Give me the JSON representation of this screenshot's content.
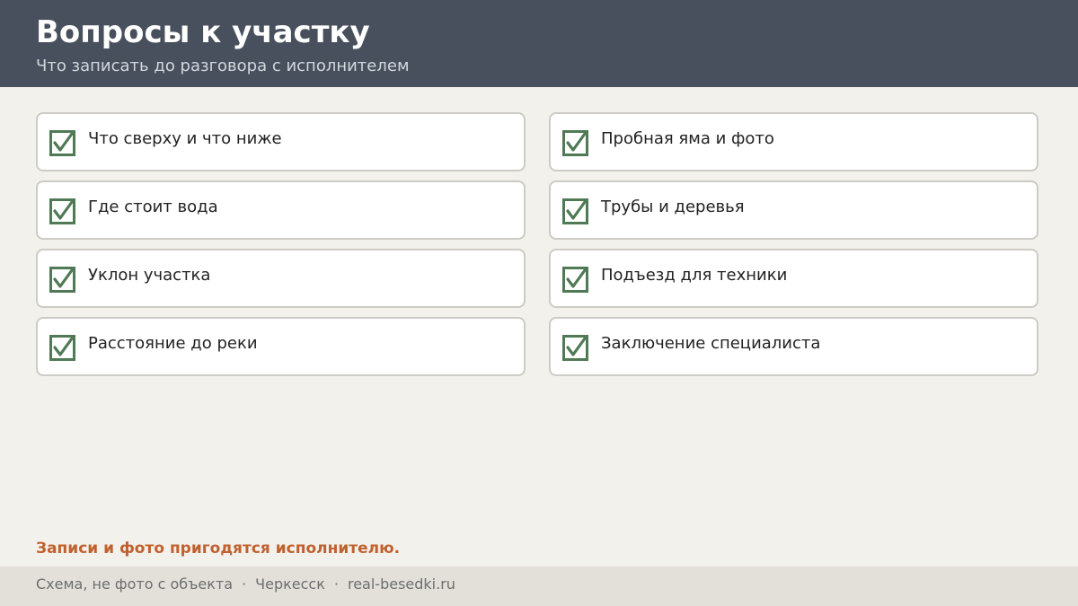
{
  "header": {
    "title": "Вопросы к участку",
    "subtitle": "Что записать до разговора с исполнителем"
  },
  "checklist": {
    "items": [
      {
        "label": "Что сверху и что ниже",
        "checked": true
      },
      {
        "label": "Пробная яма и фото",
        "checked": true
      },
      {
        "label": "Где стоит вода",
        "checked": true
      },
      {
        "label": "Трубы и деревья",
        "checked": true
      },
      {
        "label": "Уклон участка",
        "checked": true
      },
      {
        "label": "Подъезд для техники",
        "checked": true
      },
      {
        "label": "Расстояние до реки",
        "checked": true
      },
      {
        "label": "Заключение специалиста",
        "checked": true
      }
    ]
  },
  "note": "Записи и фото пригодятся исполнителю.",
  "footer": {
    "caption": "Схема, не фото с объекта",
    "separator": "·",
    "city": "Черкесск",
    "site": "real-besedki.ru"
  },
  "colors": {
    "header_bg": "#47505c",
    "background": "#f3f1ec",
    "check_green": "#4f7a55",
    "accent": "#c0612f",
    "footer_bg": "#e3e0da"
  },
  "icons": {
    "checkbox": "checkbox-checked-icon"
  }
}
